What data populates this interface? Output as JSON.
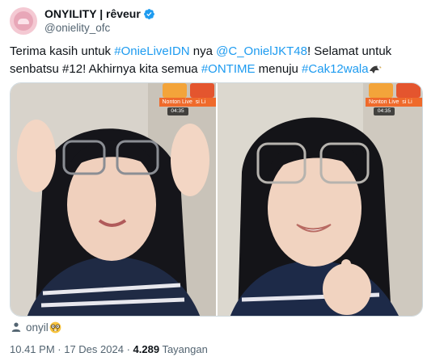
{
  "author": {
    "display_name": "ONYILITY | rêveur",
    "handle": "@onielity_ofc"
  },
  "tweet": {
    "segments": [
      {
        "text": "Terima kasih untuk ",
        "kind": "text"
      },
      {
        "text": "#OnieLiveIDN",
        "kind": "link"
      },
      {
        "text": " nya ",
        "kind": "text"
      },
      {
        "text": "@C_OnielJKT48",
        "kind": "link"
      },
      {
        "text": "! Selamat untuk senbatsu #12! Akhirnya kita semua ",
        "kind": "text"
      },
      {
        "text": "#ONTIME",
        "kind": "link"
      },
      {
        "text": " menuju ",
        "kind": "text"
      },
      {
        "text": "#Cak12wala",
        "kind": "link"
      }
    ]
  },
  "media": {
    "photos": [
      {
        "badge_label": "Nonton Live",
        "badge_label_2": "si Li",
        "badge_time": "04:35"
      },
      {
        "badge_label": "Nonton Live",
        "badge_label_2": "si Li",
        "badge_time": "04:35"
      }
    ]
  },
  "tagged": {
    "name": "onyil",
    "icon": "person-icon",
    "emoji": "nerd-face-emoji"
  },
  "meta": {
    "time": "10.41 PM",
    "separator": " · ",
    "date": "17 Des 2024",
    "views": "4.289",
    "views_label": " Tayangan"
  },
  "colors": {
    "accent": "#1d9bf0",
    "muted": "#536471",
    "text": "#0f1419"
  }
}
